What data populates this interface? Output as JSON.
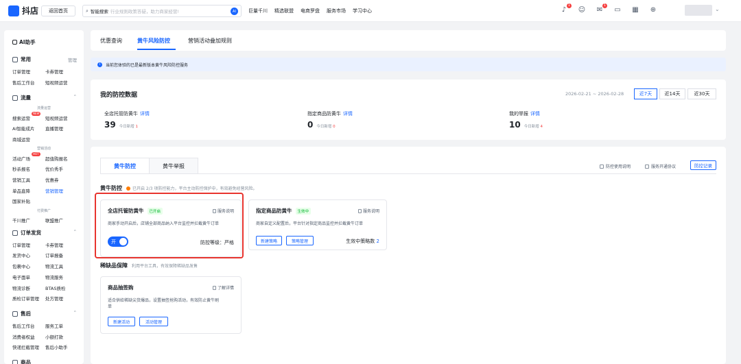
{
  "topbar": {
    "logo_glyph": "",
    "logo_text": "抖店",
    "home_button": "返回首页",
    "search_label": "智能搜索",
    "search_placeholder": "行业规则政策答疑，助力商家经营!",
    "search_ai_badge": "AI",
    "nav": [
      "巨量千川",
      "精选联盟",
      "电商罗盘",
      "服务市场",
      "学习中心"
    ],
    "badge_count_1": "1",
    "badge_count_2": "1"
  },
  "sidebar": {
    "ai_label": "AI助手",
    "common": {
      "title": "常用",
      "manage": "管理",
      "items": [
        "订单管理",
        "卡券管理",
        "售后工作台",
        "短视频运营"
      ]
    },
    "traffic": {
      "title": "流量",
      "sub1": "流量运营",
      "items1": [
        "搜索运营",
        "短视频运营",
        "AI智能成片",
        "直播管理",
        "商城运营"
      ],
      "new_tag": "NEW",
      "sub2": "营销活动",
      "items2": [
        "活动广场",
        "超值购报名",
        "秒杀报名",
        "优价秀手",
        "营销工具",
        "优惠券",
        "单品直降",
        "营销管理",
        "国家补贴"
      ],
      "hot_tag": "HOT",
      "sub3": "付费推广",
      "items3": [
        "千川推广",
        "联盟推广"
      ]
    },
    "order": {
      "title": "订单发货",
      "items": [
        "订单管理",
        "卡券管理",
        "发货中心",
        "订单报备",
        "包裹中心",
        "物流工具",
        "电子面单",
        "物流服务",
        "物流诊断",
        "BTAS质检",
        "质检订单管理",
        "处方管理"
      ]
    },
    "after_sale": {
      "title": "售后",
      "items": [
        "售后工作台",
        "服务工单",
        "消费者权益",
        "小额打款",
        "快递拦截管理",
        "售后小助手"
      ]
    },
    "goods": {
      "title": "商品"
    }
  },
  "main": {
    "tabs": [
      "优惠查询",
      "黄牛风险防控",
      "营销活动叠加规则"
    ],
    "notice": "当前您体验的已是最新版本黄牛风险防控服务",
    "data": {
      "title": "我的防控数据",
      "date_range": "2026-02-21 ~ 2026-02-28",
      "ranges": [
        "近7天",
        "近14天",
        "近30天"
      ],
      "stats": [
        {
          "label": "全店托管防黄牛",
          "link": "详情",
          "value": "39",
          "sub_prefix": "今日新增",
          "sub_value": "1"
        },
        {
          "label": "指定商品防黄牛",
          "link": "详情",
          "value": "0",
          "sub_prefix": "今日新增",
          "sub_value": "0"
        },
        {
          "label": "我的举报",
          "link": "详情",
          "value": "10",
          "sub_prefix": "今日新增",
          "sub_value": "4"
        }
      ]
    },
    "risk": {
      "tabs": [
        "黄牛防控",
        "黄牛举报"
      ],
      "links": [
        "防控使用说明",
        "服务开通协议"
      ],
      "record_button": "防控记录",
      "section1_title": "黄牛防控",
      "section1_desc": "已开启 2/3 项防控能力，平台主动防控保护中，有效避免经营风险。",
      "card1": {
        "title": "全店托管防黄牛",
        "badge": "已开启",
        "link": "服务说明",
        "desc": "商家手动开启后，店铺全部商品纳入平台监控并拦截黄牛订单",
        "toggle": "开",
        "level": "防控等级：严格"
      },
      "card2": {
        "title": "指定商品防黄牛",
        "badge": "生效中",
        "link": "服务说明",
        "desc": "商家自定义配置后，平台针对指定商品监控并拦截黄牛订单",
        "btn1": "新建策略",
        "btn2": "策略管理",
        "count_label": "生效中策略数",
        "count": "2"
      },
      "section2_title": "稀缺品保障",
      "section2_desc": "利用平台工具，有效保障稀缺品发售",
      "card3": {
        "title": "商品抽签购",
        "link": "了解详情",
        "desc_line1": "适合供给稀缺尖货爆品，设置抽签抢购活动，有效防止黄牛刷",
        "desc_line2": "单",
        "btn1": "新建活动",
        "btn2": "活动管理"
      }
    }
  },
  "colors": {
    "accent": "#1966ff",
    "highlight": "#e8342e",
    "success": "#00b42a",
    "danger": "#f53f3f"
  }
}
